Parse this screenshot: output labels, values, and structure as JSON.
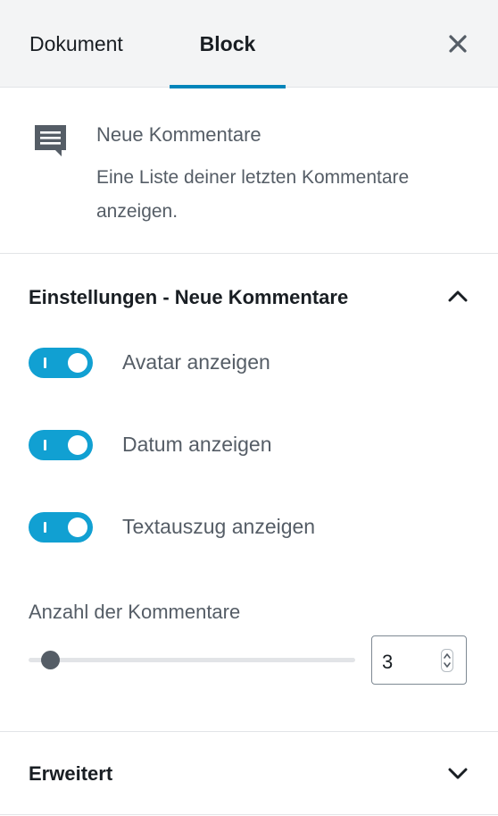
{
  "tabs": {
    "document": "Dokument",
    "block": "Block"
  },
  "block": {
    "icon": "comment-icon",
    "title": "Neue Kommentare",
    "description": "Eine Liste deiner letzten Kommentare anzeigen."
  },
  "settings": {
    "title": "Einstellungen - Neue Kommentare",
    "expanded": true,
    "toggles": [
      {
        "label": "Avatar anzeigen",
        "checked": true
      },
      {
        "label": "Datum anzeigen",
        "checked": true
      },
      {
        "label": "Textauszug anzeigen",
        "checked": true
      }
    ],
    "count_label": "Anzahl der Kommentare",
    "count_value": "3"
  },
  "advanced": {
    "title": "Erweitert",
    "expanded": false
  },
  "colors": {
    "accent": "#0085ba",
    "toggle_on": "#11a0d2",
    "text": "#191e23",
    "muted": "#555d66"
  }
}
